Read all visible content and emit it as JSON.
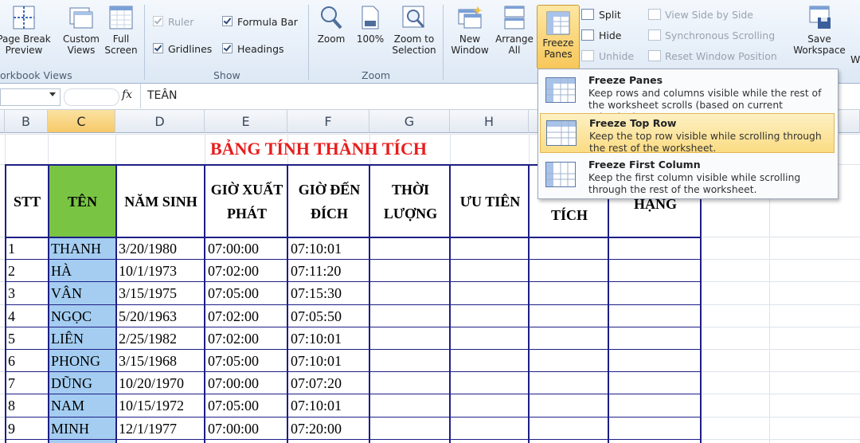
{
  "ribbon": {
    "workbook_views": {
      "page_break_label": "Page Break\nPreview",
      "custom_views_label": "Custom\nViews",
      "full_screen_label": "Full\nScreen",
      "group_label": "orkbook Views"
    },
    "show": {
      "ruler": "Ruler",
      "gridlines": "Gridlines",
      "formula_bar": "Formula Bar",
      "headings": "Headings",
      "group_label": "Show"
    },
    "zoom": {
      "zoom_label": "Zoom",
      "zoom100_label": "100%",
      "zoom_selection_label": "Zoom to\nSelection",
      "group_label": "Zoom"
    },
    "window": {
      "new_window": "New\nWindow",
      "arrange_all": "Arrange\nAll",
      "freeze_panes": "Freeze\nPanes",
      "split": "Split",
      "hide": "Hide",
      "unhide": "Unhide",
      "view_side": "View Side by Side",
      "sync_scroll": "Synchronous Scrolling",
      "reset_pos": "Reset Window Position",
      "save_workspace": "Save\nWorkspace",
      "switch_partial": "W"
    }
  },
  "formula_bar": {
    "fx": "fx",
    "content": "TEÂN"
  },
  "columns": [
    "B",
    "C",
    "D",
    "E",
    "F",
    "G",
    "H"
  ],
  "sheet": {
    "title": "BẢNG TÍNH THÀNH TÍCH",
    "headers": [
      "STT",
      "TÊN",
      "NĂM SINH",
      "GIỜ XUẤT PHÁT",
      "GIỜ ĐẾN ĐÍCH",
      "THỜI LƯỢNG",
      "ƯU TIÊN",
      "TÍCH",
      "HẠNG"
    ],
    "rows": [
      [
        "1",
        "THANH",
        "3/20/1980",
        "07:00:00",
        "07:10:01"
      ],
      [
        "2",
        "HÀ",
        "10/1/1973",
        "07:02:00",
        "07:11:20"
      ],
      [
        "3",
        "VÂN",
        "3/15/1975",
        "07:05:00",
        "07:15:30"
      ],
      [
        "4",
        "NGỌC",
        "5/20/1963",
        "07:02:00",
        "07:05:50"
      ],
      [
        "5",
        "LIÊN",
        "2/25/1982",
        "07:02:00",
        "07:10:01"
      ],
      [
        "6",
        "PHONG",
        "3/15/1968",
        "07:05:00",
        "07:10:01"
      ],
      [
        "7",
        "DŨNG",
        "10/20/1970",
        "07:00:00",
        "07:07:20"
      ],
      [
        "8",
        "NAM",
        "10/15/1972",
        "07:05:00",
        "07:10:01"
      ],
      [
        "9",
        "MINH",
        "12/1/1977",
        "07:00:00",
        "07:20:00"
      ]
    ]
  },
  "dropdown": {
    "items": [
      {
        "title": "Freeze Panes",
        "desc": "Keep rows and columns visible while the rest of the worksheet scrolls (based on current selection)."
      },
      {
        "title": "Freeze Top Row",
        "desc": "Keep the top row visible while scrolling through the rest of the worksheet."
      },
      {
        "title": "Freeze First Column",
        "desc": "Keep the first column visible while scrolling through the rest of the worksheet."
      }
    ]
  },
  "colors": {
    "title_red": "#e81d1d",
    "table_border": "#1e1e86",
    "name_col_green": "#79c543",
    "name_col_blue": "#a4cdf1",
    "highlight": "#f7c75a"
  }
}
